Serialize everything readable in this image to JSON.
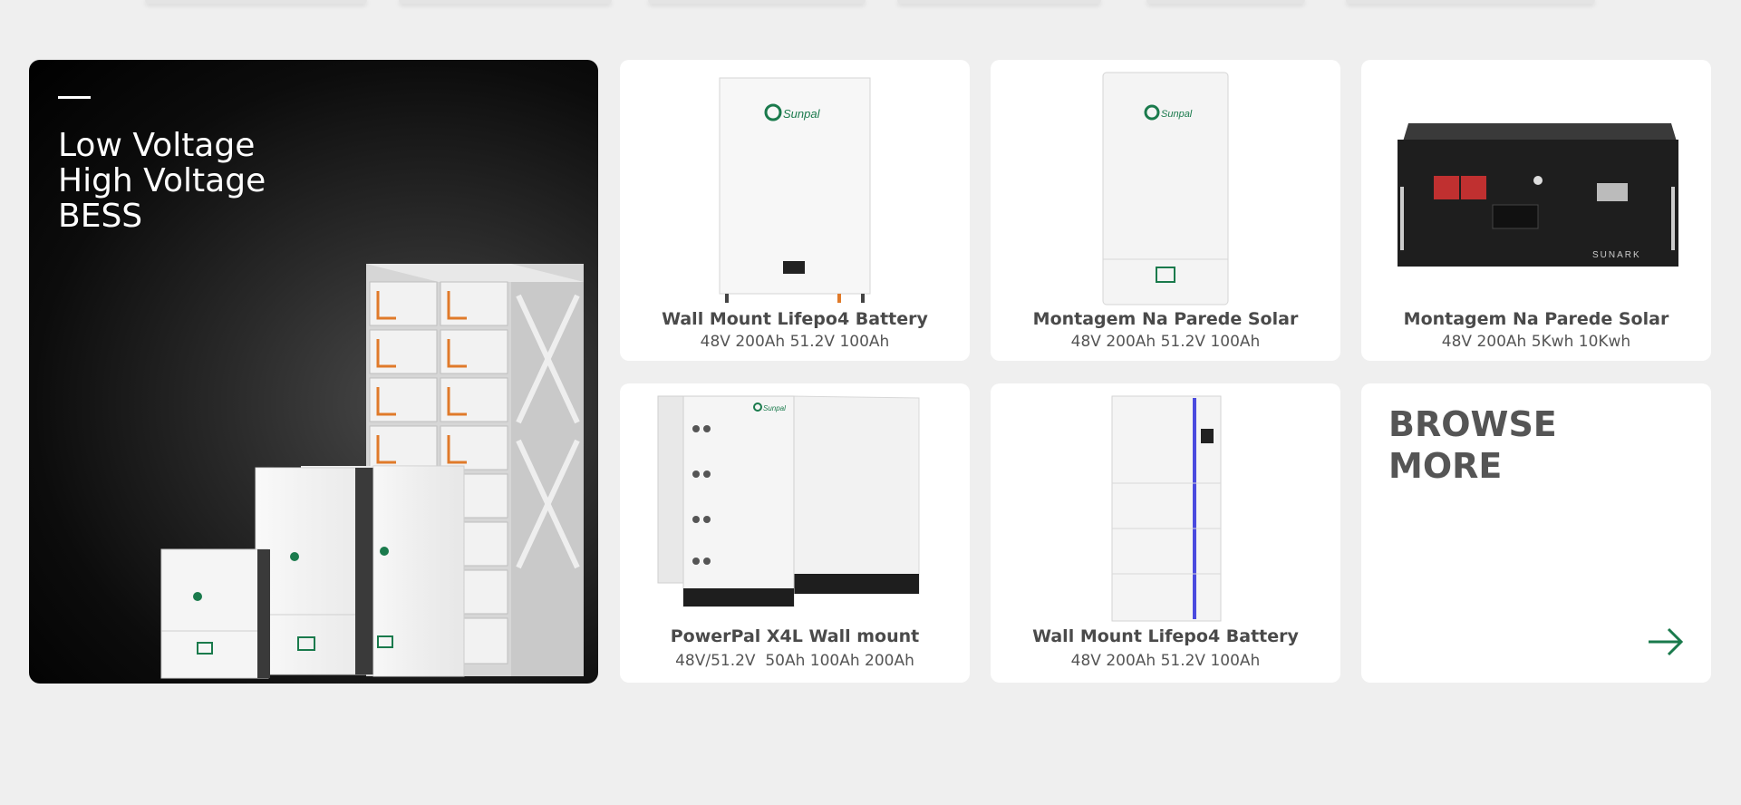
{
  "hero": {
    "lines": [
      "Low Voltage",
      "High Voltage",
      "BESS"
    ]
  },
  "products": [
    {
      "name": "Wall Mount Lifepo4 Battery",
      "spec": "48V 200Ah 51.2V 100Ah",
      "brand": "Sunpal"
    },
    {
      "name": "Montagem Na Parede Solar",
      "spec": "48V 200Ah 51.2V 100Ah",
      "brand": "Sunpal"
    },
    {
      "name": "Montagem Na Parede Solar",
      "spec": "48V 200Ah 5Kwh 10Kwh",
      "brand": "SUNARK"
    },
    {
      "name": "PowerPal X4L Wall mount",
      "spec": "48V/51.2V  50Ah 100Ah 200Ah",
      "brand": "Sunpal"
    },
    {
      "name": "Wall Mount Lifepo4 Battery",
      "spec": "48V 200Ah 51.2V 100Ah",
      "brand": ""
    }
  ],
  "browse": {
    "lines": [
      "BROWSE",
      "MORE"
    ],
    "icon": "arrow-right-icon"
  },
  "colors": {
    "page_bg": "#efefef",
    "card_bg": "#ffffff",
    "brand_green": "#1a7a4c",
    "accent_blue": "#4a4adf",
    "text_dark": "#4a4a4a"
  }
}
